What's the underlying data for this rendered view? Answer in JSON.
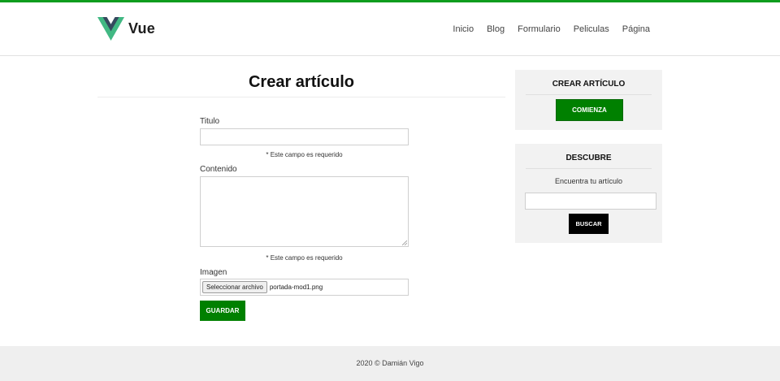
{
  "colors": {
    "accent_green": "#008000",
    "top_bar": "#0f9d1d",
    "vue_dark": "#35495e",
    "vue_green": "#41b883",
    "card_bg": "#f2f2f2",
    "footer_bg": "#efefef"
  },
  "header": {
    "logo_icon": "vue-logo-icon",
    "logo_text": "Vue",
    "nav": [
      {
        "label": "Inicio"
      },
      {
        "label": "Blog"
      },
      {
        "label": "Formulario"
      },
      {
        "label": "Peliculas"
      },
      {
        "label": "Página"
      }
    ]
  },
  "main": {
    "title": "Crear artículo",
    "form": {
      "title_label": "Titulo",
      "title_value": "",
      "title_required": "* Este campo es requerido",
      "content_label": "Contenido",
      "content_value": "",
      "content_required": "* Este campo es requerido",
      "image_label": "Imagen",
      "file_button": "Seleccionar archivo",
      "file_name": "portada-mod1.png",
      "save_button": "GUARDAR"
    }
  },
  "sidebar": {
    "create_card": {
      "title": "CREAR ARTÍCULO",
      "button": "COMIENZA"
    },
    "discover_card": {
      "title": "DESCUBRE",
      "text": "Encuentra tu artículo",
      "search_value": "",
      "button": "BUSCAR"
    }
  },
  "footer": {
    "text": "2020 © Damián Vigo"
  }
}
